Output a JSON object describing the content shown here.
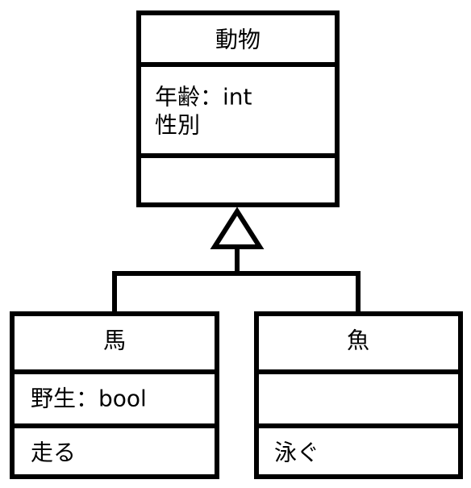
{
  "classes": {
    "animal": {
      "name": "動物",
      "attributes": [
        "年齢：int",
        "性別"
      ],
      "operations": []
    },
    "horse": {
      "name": "馬",
      "attributes": [
        "野生：bool"
      ],
      "operations": [
        "走る"
      ]
    },
    "fish": {
      "name": "魚",
      "attributes": [],
      "operations": [
        "泳ぐ"
      ]
    }
  },
  "relationships": [
    {
      "type": "generalization",
      "parent": "動物",
      "children": [
        "馬",
        "魚"
      ]
    }
  ]
}
